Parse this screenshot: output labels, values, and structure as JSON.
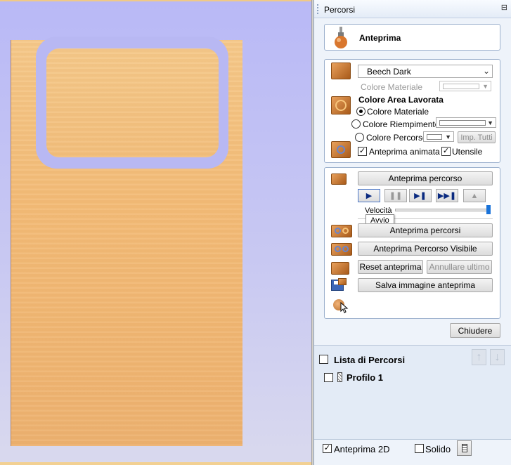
{
  "panel": {
    "title": "Percorsi",
    "pin_icon": "pin-icon"
  },
  "preview_header": {
    "title": "Anteprima",
    "icon": "router-bit-icon"
  },
  "material": {
    "selected": "Beech Dark",
    "material_color_label": "Colore Materiale",
    "machined_area_title": "Colore Area Lavorata",
    "radio_options": [
      "Colore Materiale",
      "Colore Riempimento",
      "Colore Percorso"
    ],
    "selected_radio": "Colore Materiale",
    "apply_all_label": "Imp. Tutti",
    "animated_label": "Anteprima animata",
    "tool_label": "Utensile",
    "animated_checked": true,
    "tool_checked": true
  },
  "playback": {
    "preview_path_label": "Anteprima percorso",
    "speed_label": "Velocità",
    "speed_value": 1.0,
    "tooltip": "Avvio",
    "preview_paths_label": "Anteprima percorsi",
    "preview_visible_label": "Anteprima Percorso Visibile",
    "reset_label": "Reset anteprima",
    "undo_last_label": "Annullare ultimo",
    "save_image_label": "Salva immagine anteprima",
    "close_label": "Chiudere"
  },
  "toolpath_list": {
    "title": "Lista di Percorsi",
    "items": [
      {
        "name": "Profilo 1",
        "checked": false
      }
    ]
  },
  "footer": {
    "preview_2d_label": "Anteprima 2D",
    "preview_2d_checked": true,
    "solid_label": "Solido",
    "solid_checked": false
  },
  "colors": {
    "wood": "#f3bc78",
    "background": "#c2c2f4",
    "panel_bg": "#eef3fa",
    "accent_slider": "#1a73d9"
  }
}
